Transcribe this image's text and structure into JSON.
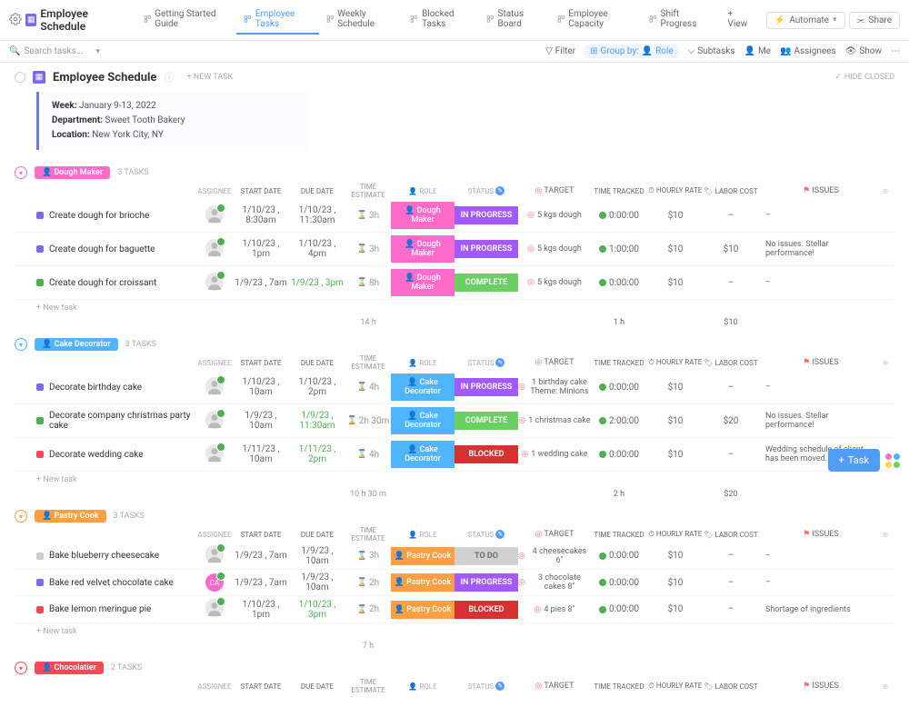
{
  "header": {
    "title": "Employee Schedule",
    "tabs": [
      {
        "label": "Getting Started Guide",
        "active": false
      },
      {
        "label": "Employee Tasks",
        "active": true
      },
      {
        "label": "Weekly Schedule",
        "active": false
      },
      {
        "label": "Blocked Tasks",
        "active": false
      },
      {
        "label": "Status Board",
        "active": false
      },
      {
        "label": "Employee Capacity",
        "active": false
      },
      {
        "label": "Shift Progress",
        "active": false
      }
    ],
    "add_view": "+ View",
    "automate": "Automate",
    "share": "Share"
  },
  "toolbar": {
    "search_placeholder": "Search tasks...",
    "filter": "Filter",
    "group_by": "Group by:",
    "group_val": "Role",
    "subtasks": "Subtasks",
    "me": "Me",
    "assignees": "Assignees",
    "show": "Show"
  },
  "page": {
    "title": "Employee Schedule",
    "new_task": "+ NEW TASK",
    "hide_closed": "HIDE CLOSED"
  },
  "info": {
    "week_label": "Week:",
    "week_val": "January 9-13, 2022",
    "dept_label": "Department:",
    "dept_val": "Sweet Tooth Bakery",
    "loc_label": "Location:",
    "loc_val": "New York City, NY"
  },
  "columns": {
    "assignee": "ASSIGNEE",
    "start": "START DATE",
    "due": "DUE DATE",
    "est": "TIME ESTIMATE",
    "role": "ROLE",
    "status": "STATUS",
    "target": "TARGET",
    "tracked": "TIME TRACKED",
    "rate": "HOURLY RATE",
    "labor": "LABOR COST",
    "issues": "ISSUES"
  },
  "groups": [
    {
      "id": "dough",
      "chip": "Dough Maker",
      "count": "3 TASKS",
      "collapse": "pink",
      "tasks": [
        {
          "sq": "purple",
          "name": "Create dough for brioche",
          "start": "1/10/23 , 8:30am",
          "due": "1/10/23 , 11:30am",
          "due_green": false,
          "est": "3h",
          "role": "Dough Maker",
          "role_cls": "dough",
          "status": "IN PROGRESS",
          "status_cls": "progress",
          "target": "5 kgs dough",
          "tracked": "0:00:00",
          "rate": "$10",
          "labor": "–",
          "issues": "–"
        },
        {
          "sq": "purple",
          "name": "Create dough for baguette",
          "start": "1/10/23 , 1pm",
          "due": "1/10/23 , 4pm",
          "due_green": false,
          "est": "3h",
          "role": "Dough Maker",
          "role_cls": "dough",
          "status": "IN PROGRESS",
          "status_cls": "progress",
          "target": "5 kgs dough",
          "tracked": "1:00:00",
          "rate": "$10",
          "labor": "$10",
          "issues": "No issues. Stellar performance!"
        },
        {
          "sq": "green",
          "name": "Create dough for croissant",
          "start": "1/9/23 , 7am",
          "due": "1/9/23 , 3pm",
          "due_green": true,
          "est": "8h",
          "role": "Dough Maker",
          "role_cls": "dough",
          "status": "COMPLETE",
          "status_cls": "complete",
          "target": "5 kgs dough",
          "tracked": "0:00:00",
          "rate": "$10",
          "labor": "–",
          "issues": "–"
        }
      ],
      "totals": {
        "est": "14 h",
        "tracked": "1 h",
        "labor": "$10"
      }
    },
    {
      "id": "decor",
      "chip": "Cake Decorator",
      "count": "3 TASKS",
      "collapse": "blue",
      "tasks": [
        {
          "sq": "purple",
          "name": "Decorate birthday cake",
          "start": "1/10/23 , 10am",
          "due": "1/10/23 , 2pm",
          "due_green": false,
          "est": "4h",
          "role": "Cake Decorator",
          "role_cls": "decor",
          "status": "IN PROGRESS",
          "status_cls": "progress",
          "target": "1 birthday cake Theme: Minions",
          "tracked": "0:00:00",
          "rate": "$10",
          "labor": "–",
          "issues": "–"
        },
        {
          "sq": "green",
          "name": "Decorate company christmas party cake",
          "start": "1/9/23 , 10am",
          "due": "1/9/23 , 11:30am",
          "due_green": true,
          "est": "2h 30m",
          "role": "Cake Decorator",
          "role_cls": "decor",
          "status": "COMPLETE",
          "status_cls": "complete",
          "target": "1 christmas cake",
          "tracked": "2:00:00",
          "rate": "$10",
          "labor": "$20",
          "issues": "No issues. Stellar performance!"
        },
        {
          "sq": "red",
          "name": "Decorate wedding cake",
          "start": "1/11/23 , 10am",
          "due": "1/11/23 , 2pm",
          "due_green": true,
          "est": "4h",
          "role": "Cake Decorator",
          "role_cls": "decor",
          "status": "BLOCKED",
          "status_cls": "blocked",
          "target": "1 wedding cake",
          "tracked": "0:00:00",
          "rate": "$10",
          "labor": "–",
          "issues": "Wedding schedule of client has been moved."
        }
      ],
      "totals": {
        "est": "10 h 30 m",
        "tracked": "2 h",
        "labor": "$20"
      }
    },
    {
      "id": "pastry",
      "chip": "Pastry Cook",
      "count": "3 TASKS",
      "collapse": "orange",
      "tasks": [
        {
          "sq": "gray",
          "name": "Bake blueberry cheesecake",
          "start": "1/9/23 , 7am",
          "due": "1/9/23 , 10am",
          "due_green": false,
          "est": "3h",
          "role": "Pastry Cook",
          "role_cls": "pastry",
          "status": "TO DO",
          "status_cls": "todo",
          "target": "4 cheesecakes 6\"",
          "tracked": "0:00:00",
          "rate": "$10",
          "labor": "–",
          "issues": "–"
        },
        {
          "sq": "purple",
          "name": "Bake red velvet chocolate cake",
          "start": "1/9/23 , 7am",
          "due": "1/9/23 , 10am",
          "due_green": false,
          "est": "2h",
          "role": "Pastry Cook",
          "role_cls": "pastry",
          "status": "IN PROGRESS",
          "status_cls": "progress",
          "target": "3 chocolate cakes 8\"",
          "tracked": "0:00:00",
          "rate": "$10",
          "labor": "–",
          "issues": "–",
          "avatar_pink": "CA"
        },
        {
          "sq": "red",
          "name": "Bake lemon meringue pie",
          "start": "1/10/23 , 1pm",
          "due": "1/10/23 , 3pm",
          "due_green": true,
          "est": "2h",
          "role": "Pastry Cook",
          "role_cls": "pastry",
          "status": "BLOCKED",
          "status_cls": "blocked",
          "target": "4 pies 8\"",
          "tracked": "0:00:00",
          "rate": "$10",
          "labor": "–",
          "issues": "Shortage of ingredients"
        }
      ],
      "totals": {
        "est": "7 h",
        "tracked": "",
        "labor": ""
      }
    },
    {
      "id": "choc",
      "chip": "Chocolatier",
      "count": "2 TASKS",
      "collapse": "red",
      "tasks": []
    }
  ],
  "fab": {
    "task": "Task"
  }
}
